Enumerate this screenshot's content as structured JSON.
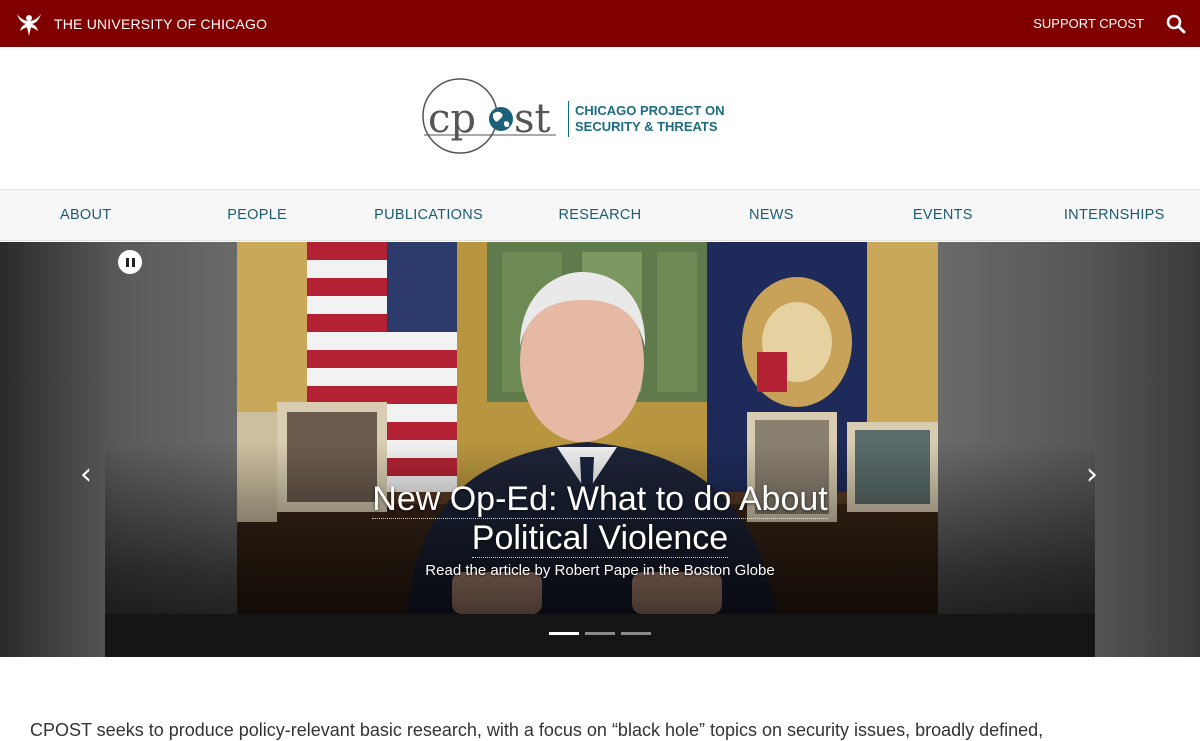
{
  "topbar": {
    "university": "THE UNIVERSITY OF CHICAGO",
    "support": "SUPPORT CPOST",
    "search_icon": "search-icon"
  },
  "logo": {
    "wordmark": "cpost",
    "tagline_line1": "CHICAGO PROJECT ON",
    "tagline_line2": "SECURITY & THREATS"
  },
  "nav": {
    "items": [
      "ABOUT",
      "PEOPLE",
      "PUBLICATIONS",
      "RESEARCH",
      "NEWS",
      "EVENTS",
      "INTERNSHIPS"
    ]
  },
  "hero": {
    "title_line1": "New Op-Ed: What to do About",
    "title_line2": "Political Violence",
    "subtitle": "Read the article by Robert Pape in the Boston Globe",
    "prev_glyph": "‹",
    "next_glyph": "›",
    "slide_count": 3,
    "active_slide": 1
  },
  "intro": {
    "text": "CPOST seeks to produce policy-relevant basic research, with a focus on “black hole” topics on security issues, broadly defined,"
  },
  "colors": {
    "maroon": "#800000",
    "nav_text": "#1d5b72",
    "logo_teal": "#1d6b7f"
  }
}
